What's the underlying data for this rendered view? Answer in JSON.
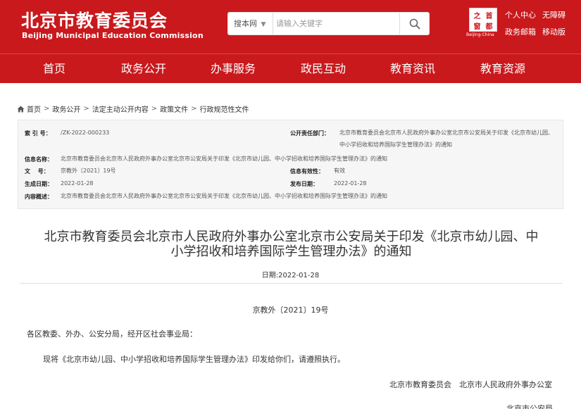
{
  "header": {
    "logo_cn": "北京市教育委员会",
    "logo_en": "Beijing Municipal Education Commission",
    "search_scope": "搜本网",
    "search_placeholder": "请输入关键字",
    "seal_chars": [
      "首",
      "都",
      "之",
      "窗"
    ],
    "seal_caption": "Beijing-China",
    "links": {
      "personal_center": "个人中心",
      "accessibility": "无障碍",
      "gov_mail": "政务邮箱",
      "mobile": "移动版"
    }
  },
  "nav": {
    "items": [
      "首页",
      "政务公开",
      "办事服务",
      "政民互动",
      "教育资讯",
      "教育资源"
    ]
  },
  "breadcrumb": [
    "首页",
    "政务公开",
    "法定主动公开内容",
    "政策文件",
    "行政规范性文件"
  ],
  "info": {
    "index_no_label": "索 引 号：",
    "index_no": "/ZK-2022-000233",
    "responsible_label": "公开责任部门：",
    "responsible_line1": "北京市教育委员会北京市人民政府外事办公室北京市公安局关于印发《北京市幼儿园、",
    "responsible_line2": "中小学招收和培养国际学生管理办法》的通知",
    "name_label": "信息名称：",
    "name": "北京市教育委员会北京市人民政府外事办公室北京市公安局关于印发《北京市幼儿园、中小学招收和培养国际学生管理办法》的通知",
    "doc_no_label": "文　 号：",
    "doc_no": "京教外〔2021〕19号",
    "validity_label": "信息有效性：",
    "validity": "有效",
    "created_label": "生成日期：",
    "created": "2022-01-28",
    "published_label": "发布日期：",
    "published": "2022-01-28",
    "summary_label": "内容概述：",
    "summary": "北京市教育委员会北京市人民政府外事办公室北京市公安局关于印发《北京市幼儿园、中小学招收和培养国际学生管理办法》的通知"
  },
  "article": {
    "title_line1": "北京市教育委员会北京市人民政府外事办公室北京市公安局关于印发《北京市幼儿园、中",
    "title_line2": "小学招收和培养国际学生管理办法》的通知",
    "date": "日期:2022-01-28",
    "doc_no": "京教外〔2021〕19号",
    "addressee": "各区教委、外办、公安分局，经开区社会事业局：",
    "body": "现将《北京市幼儿园、中小学招收和培养国际学生管理办法》印发给你们，请遵照执行。",
    "signers_line1": "北京市教育委员会　北京市人民政府外事办公室",
    "signers_line2": "北京市公安局"
  },
  "colors": {
    "brand_red": "#c9191d",
    "info_bg": "#f6f6f6"
  },
  "icons": [
    "search-icon",
    "chevron-down-icon",
    "home-icon"
  ]
}
